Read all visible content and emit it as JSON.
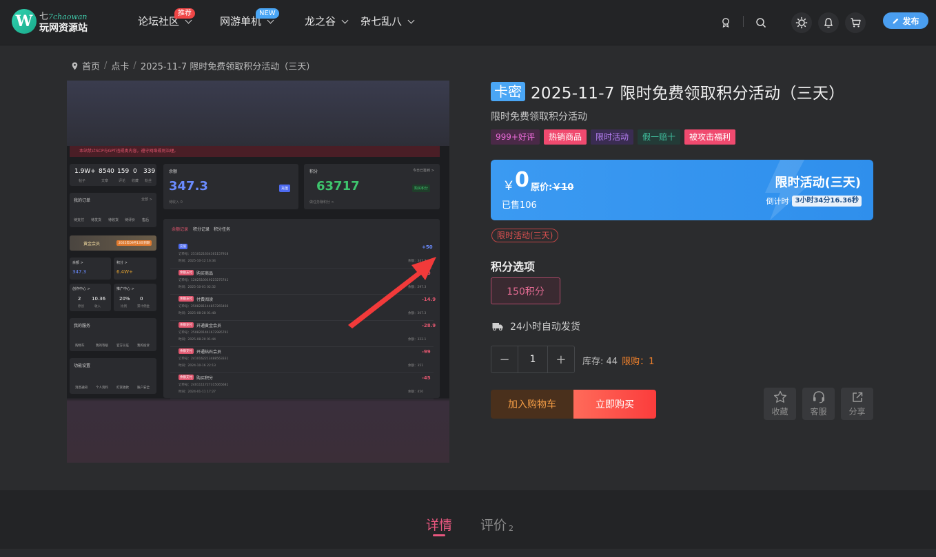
{
  "header": {
    "logo_top": "七",
    "logo_script": "7chaowan",
    "logo_bottom": "玩网资源站",
    "nav": [
      {
        "label": "论坛社区",
        "badge": "推荐",
        "badge_color": "#f04646"
      },
      {
        "label": "网游单机",
        "badge": "NEW",
        "badge_color": "#4aa6f5"
      },
      {
        "label": "龙之谷"
      },
      {
        "label": "杂七乱八"
      }
    ],
    "publish_label": "发布"
  },
  "breadcrumb": [
    "首页",
    "点卡",
    "2025-11-7 限时免费领取积分活动（三天）"
  ],
  "product_image": {
    "alert": "本站禁止SCP与GPT违规类内容，遵守网络规则治理。",
    "stats": [
      {
        "value": "1.9W+",
        "label": "帖子"
      },
      {
        "value": "8540",
        "label": "文章"
      },
      {
        "value": "159",
        "label": "评论"
      },
      {
        "value": "0",
        "label": "收藏"
      },
      {
        "value": "339",
        "label": "粉丝"
      }
    ],
    "balance": {
      "title": "余额",
      "value": "347.3",
      "btn": "充值",
      "sub": "待收入 0"
    },
    "points": {
      "title": "积分",
      "value": "63717",
      "btn": "购买积分",
      "sub": "做任务赚积分 >",
      "checkin": "今日已签到 >"
    },
    "orders_title": "我的订单",
    "orders_all": "全部 >",
    "order_items": [
      "待支付",
      "待发货",
      "待收货",
      "待评价",
      "售后"
    ],
    "vip": "黄金会员",
    "vip_exp": "2025年09月13日到期",
    "mini_balance_label": "余额 >",
    "mini_balance": "347.3",
    "mini_points_label": "积分 >",
    "mini_points": "6.4W+",
    "creator": {
      "title": "创作中心 >",
      "a": "2",
      "a_label": "原创",
      "b": "10.36",
      "b_label": "收入"
    },
    "promo_center": {
      "title": "推广中心 >",
      "a": "20%",
      "a_label": "比例",
      "b": "0",
      "b_label": "累计佣金"
    },
    "services_title": "我的服务",
    "services": [
      "购物车",
      "我的等级",
      "官方认证",
      "我的投诉"
    ],
    "settings_title": "功能设置",
    "settings": [
      "消息通知",
      "个人资料",
      "打赏收款",
      "账户安全"
    ],
    "tabs": [
      "余额记录",
      "积分记录",
      "积分任务"
    ],
    "records": [
      {
        "tag": "充值",
        "title": "",
        "amount": "+50",
        "no": "订单号：2510121634161157918",
        "time": "时间：2025-10-12 16:34",
        "bal": "余额：347.3"
      },
      {
        "tag": "余额支付",
        "title": "购买商品",
        "amount": "-10",
        "no": "订单号：1202510019223275741",
        "time": "时间：2025-10-01 02:32",
        "bal": "余额：297.3"
      },
      {
        "tag": "余额支付",
        "title": "付费阅读",
        "amount": "-14.9",
        "no": "订单号：2508281144857265466",
        "time": "时间：2025-08-28 01:48",
        "bal": "余额：307.3"
      },
      {
        "tag": "余额支付",
        "title": "开通黄金会员",
        "amount": "-28.9",
        "no": "订单号：2508201441672985791",
        "time": "时间：2025-08-20 01:44",
        "bal": "余额：322.1"
      },
      {
        "tag": "余额支付",
        "title": "开通钻石会员",
        "amount": "-99",
        "no": "订单号：2410162213488563331",
        "time": "时间：2024-10-16 22:13",
        "bal": "余额：351"
      },
      {
        "tag": "余额支付",
        "title": "购买积分",
        "amount": "-45",
        "no": "订单号：2401111727315065681",
        "time": "时间：2024-01-11 17:27",
        "bal": "余额：450"
      }
    ]
  },
  "product": {
    "type_badge": "卡密",
    "title": "2025-11-7 限时免费领取积分活动（三天）",
    "subtitle": "限时免费领取积分活动",
    "tags": [
      {
        "text": "999+好评",
        "bg": "#4a2947",
        "fg": "#e96ad7"
      },
      {
        "text": "热销商品",
        "bg": "#f04a6f",
        "fg": "#ffffff"
      },
      {
        "text": "限时活动",
        "bg": "#3a2c52",
        "fg": "#b57ef2"
      },
      {
        "text": "假一赔十",
        "bg": "#233b37",
        "fg": "#40c2a0"
      },
      {
        "text": "被攻击福利",
        "bg": "#f04a6f",
        "fg": "#ffffff"
      }
    ],
    "price_symbol": "￥",
    "price": "0",
    "orig_label": "原价:",
    "orig_price": "￥10",
    "sold": "已售106",
    "promo_title": "限时活动(三天)",
    "countdown_label": "倒计时",
    "countdown": "3小时34分16.36秒",
    "promo_tag": "限时活动(三天)",
    "options_label": "积分选项",
    "option": "150积分",
    "shipping": "24小时自动发货",
    "qty": "1",
    "stock": "库存: 44",
    "limit": "限购：1",
    "add_cart": "加入购物车",
    "buy_now": "立即购买",
    "actions": [
      "收藏",
      "客服",
      "分享"
    ]
  },
  "tabs": {
    "detail": "详情",
    "review": "评价",
    "review_count": "2"
  }
}
